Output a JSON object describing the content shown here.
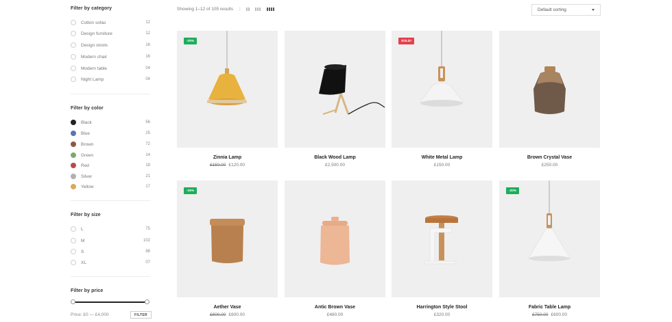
{
  "sidebar": {
    "category": {
      "title": "Filter by category",
      "items": [
        {
          "label": "Cotton sofas",
          "count": "12"
        },
        {
          "label": "Design furniture",
          "count": "12"
        },
        {
          "label": "Design stools",
          "count": "16"
        },
        {
          "label": "Modern chair",
          "count": "16"
        },
        {
          "label": "Modern table",
          "count": "04"
        },
        {
          "label": "Night Lamp",
          "count": "04"
        }
      ]
    },
    "color": {
      "title": "Filter by color",
      "items": [
        {
          "label": "Black",
          "count": "56",
          "color": "#222222"
        },
        {
          "label": "Blue",
          "count": "25",
          "color": "#5b74b8"
        },
        {
          "label": "Brown",
          "count": "72",
          "color": "#8a5a44"
        },
        {
          "label": "Green",
          "count": "14",
          "color": "#7cab6a"
        },
        {
          "label": "Red",
          "count": "18",
          "color": "#b94b4b"
        },
        {
          "label": "Silver",
          "count": "21",
          "color": "#b0b0b0"
        },
        {
          "label": "Yellow",
          "count": "17",
          "color": "#d9a95b"
        }
      ]
    },
    "size": {
      "title": "Filter by size",
      "items": [
        {
          "label": "L",
          "count": "75"
        },
        {
          "label": "M",
          "count": "102"
        },
        {
          "label": "S",
          "count": "88"
        },
        {
          "label": "XL",
          "count": "07"
        }
      ]
    },
    "price": {
      "title": "Filter by price",
      "range_text": "Price: £0 — £4,000",
      "button_label": "FILTER"
    }
  },
  "toolbar": {
    "result_count": "Showing 1–12 of 105 results",
    "separator": "|",
    "view_icons": [
      "list-view-icon",
      "grid-3-view-icon",
      "grid-4-view-icon"
    ],
    "sort_label": "Default sorting"
  },
  "products": [
    {
      "name": "Zinnia Lamp",
      "old_price": "£150.00",
      "price": "£120.00",
      "badge": "-20%",
      "badge_type": "sale"
    },
    {
      "name": "Black Wood Lamp",
      "old_price": "",
      "price": "£2,500.00",
      "badge": "",
      "badge_type": ""
    },
    {
      "name": "White Metal Lamp",
      "old_price": "",
      "price": "£150.00",
      "badge": "SOLD!",
      "badge_type": "sold"
    },
    {
      "name": "Brown Crystal Vase",
      "old_price": "",
      "price": "£250.00",
      "badge": "",
      "badge_type": ""
    },
    {
      "name": "Aether Vase",
      "old_price": "£800.00",
      "price": "£600.00",
      "badge": "-25%",
      "badge_type": "sale"
    },
    {
      "name": "Antic Brown Vase",
      "old_price": "",
      "price": "£480.00",
      "badge": "",
      "badge_type": ""
    },
    {
      "name": "Harrington Style Stool",
      "old_price": "",
      "price": "£320.00",
      "badge": "",
      "badge_type": ""
    },
    {
      "name": "Fabric Table Lamp",
      "old_price": "£750.00",
      "price": "£600.00",
      "badge": "-20%",
      "badge_type": "sale"
    }
  ]
}
